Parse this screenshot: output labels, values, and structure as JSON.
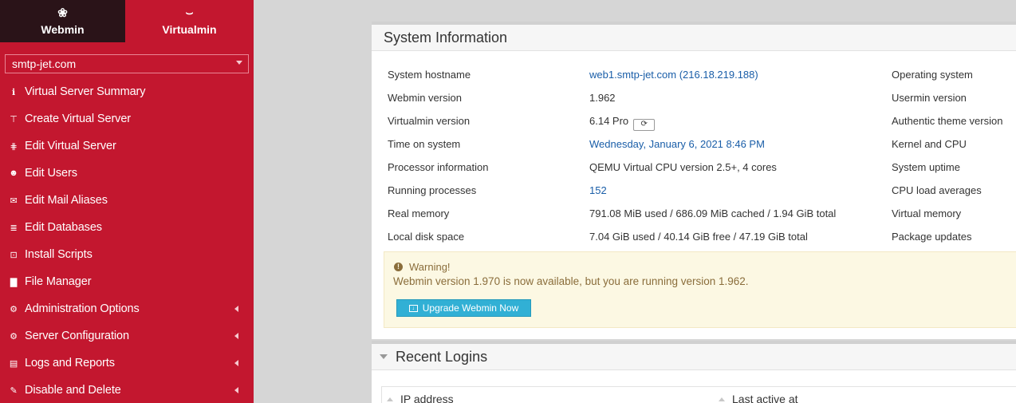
{
  "switcher": {
    "webmin_label": "Webmin",
    "virtualmin_label": "Virtualmin"
  },
  "domain_select": {
    "value": "smtp-jet.com"
  },
  "nav": [
    {
      "label": "Virtual Server Summary",
      "icon": "info-icon",
      "glyph": "ℹ"
    },
    {
      "label": "Create Virtual Server",
      "icon": "create-server-icon",
      "glyph": "⊤"
    },
    {
      "label": "Edit Virtual Server",
      "icon": "sliders-icon",
      "glyph": "⋕"
    },
    {
      "label": "Edit Users",
      "icon": "users-icon",
      "glyph": "☻"
    },
    {
      "label": "Edit Mail Aliases",
      "icon": "mail-alias-icon",
      "glyph": "✉"
    },
    {
      "label": "Edit Databases",
      "icon": "database-icon",
      "glyph": "≣"
    },
    {
      "label": "Install Scripts",
      "icon": "install-icon",
      "glyph": "⊡"
    },
    {
      "label": "File Manager",
      "icon": "folder-icon",
      "glyph": "▇"
    },
    {
      "label": "Administration Options",
      "icon": "settings-icon",
      "glyph": "⚙"
    },
    {
      "label": "Server Configuration",
      "icon": "gears-icon",
      "glyph": "⚙"
    },
    {
      "label": "Logs and Reports",
      "icon": "file-icon",
      "glyph": "▤"
    },
    {
      "label": "Disable and Delete",
      "icon": "plug-icon",
      "glyph": "✎"
    }
  ],
  "system_info": {
    "title": "System Information",
    "rows": [
      {
        "label": "System hostname",
        "value": "web1.smtp-jet.com (216.18.219.188)",
        "right_label": "Operating system"
      },
      {
        "label": "Webmin version",
        "value": "1.962",
        "right_label": "Usermin version"
      },
      {
        "label": "Virtualmin version",
        "value": "6.14 Pro",
        "right_label": "Authentic theme version"
      },
      {
        "label": "Time on system",
        "value": "Wednesday, January 6, 2021 8:46 PM",
        "right_label": "Kernel and CPU"
      },
      {
        "label": "Processor information",
        "value": "QEMU Virtual CPU version 2.5+, 4 cores",
        "right_label": "System uptime"
      },
      {
        "label": "Running processes",
        "value": "152",
        "right_label": "CPU load averages"
      },
      {
        "label": "Real memory",
        "value": "791.08 MiB used / 686.09 MiB cached / 1.94 GiB total",
        "right_label": "Virtual memory"
      },
      {
        "label": "Local disk space",
        "value": "7.04 GiB used / 40.14 GiB free / 47.19 GiB total",
        "right_label": "Package updates"
      }
    ]
  },
  "warning": {
    "title": "Warning!",
    "message": "Webmin version 1.970 is now available, but you are running version 1.962.",
    "button_label": "Upgrade Webmin Now"
  },
  "recent_logins": {
    "title": "Recent Logins",
    "columns": [
      "IP address",
      "Last active at"
    ]
  }
}
